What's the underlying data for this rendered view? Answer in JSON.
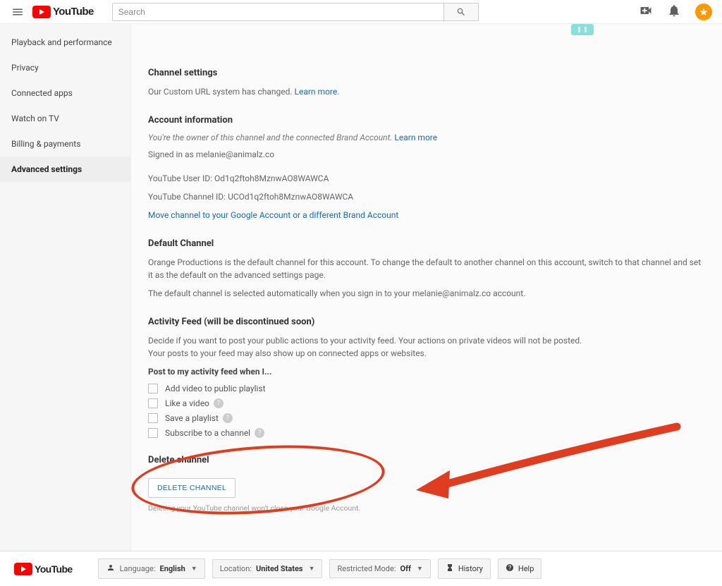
{
  "header": {
    "search_placeholder": "Search",
    "logo_text": "YouTube"
  },
  "sidebar": {
    "items": [
      {
        "label": "Playback and performance",
        "active": false
      },
      {
        "label": "Privacy",
        "active": false
      },
      {
        "label": "Connected apps",
        "active": false
      },
      {
        "label": "Watch on TV",
        "active": false
      },
      {
        "label": "Billing & payments",
        "active": false
      },
      {
        "label": "Advanced settings",
        "active": true
      }
    ]
  },
  "channel_settings": {
    "title": "Channel settings",
    "body": "Our Custom URL system has changed. ",
    "link": "Learn more"
  },
  "account_info": {
    "title": "Account information",
    "owner_line": "You're the owner of this channel and the connected Brand Account. ",
    "owner_link": "Learn more",
    "signed_in_as": "Signed in as melanie@animalz.co",
    "user_id_label": "YouTube User ID: ",
    "user_id": "Od1q2ftoh8MznwAO8WAWCA",
    "channel_id_label": "YouTube Channel ID: ",
    "channel_id": "UCOd1q2ftoh8MznwAO8WAWCA",
    "move_link": "Move channel to your Google Account or a different Brand Account"
  },
  "default_channel": {
    "title": "Default Channel",
    "body1": "Orange Productions is the default channel for this account. To change the default to another channel on this account, switch to that channel and set it as the default on the advanced settings page.",
    "body2": "The default channel is selected automatically when you sign in to your melanie@animalz.co account."
  },
  "activity_feed": {
    "title": "Activity Feed (will be discontinued soon)",
    "body": "Decide if you want to post your public actions to your activity feed. Your actions on private videos will not be posted. Your posts to your feed may also show up on connected apps or websites.",
    "post_title": "Post to my activity feed when I...",
    "options": [
      {
        "label": "Add video to public playlist",
        "help": false
      },
      {
        "label": "Like a video",
        "help": true
      },
      {
        "label": "Save a playlist",
        "help": true
      },
      {
        "label": "Subscribe to a channel",
        "help": true
      }
    ]
  },
  "delete": {
    "title": "Delete channel",
    "button": "DELETE CHANNEL",
    "note": "Deleting your YouTube channel won't close your Google Account."
  },
  "footer": {
    "language_label": "Language: ",
    "language_value": "English",
    "location_label": "Location: ",
    "location_value": "United States",
    "restricted_label": "Restricted Mode: ",
    "restricted_value": "Off",
    "history": "History",
    "help": "Help"
  }
}
